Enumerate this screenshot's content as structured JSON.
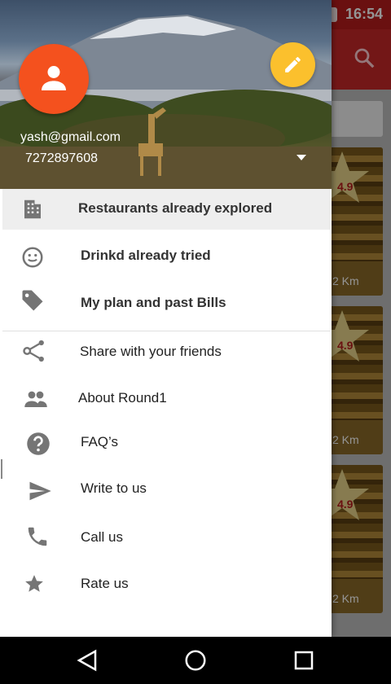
{
  "status_bar": {
    "time": "16:54"
  },
  "background": {
    "cards": [
      {
        "rating": "4.9",
        "distance": "2 Km"
      },
      {
        "rating": "4.9",
        "distance": "2 Km"
      },
      {
        "rating": "4.9",
        "distance": "2 Km"
      }
    ]
  },
  "drawer": {
    "account": {
      "email": "yash@gmail.com",
      "phone": "7272897608"
    },
    "menu": [
      {
        "label": "Restaurants already explored",
        "icon": "building-icon"
      },
      {
        "label": "Drinkd already tried",
        "icon": "smiley-icon"
      },
      {
        "label": "My plan and past Bills",
        "icon": "tag-icon"
      },
      {
        "label": "Share with your friends",
        "icon": "share-icon"
      },
      {
        "label": "About Round1",
        "icon": "people-icon"
      },
      {
        "label": "FAQ’s",
        "icon": "help-icon"
      },
      {
        "label": "Write to us",
        "icon": "send-icon"
      },
      {
        "label": "Call us",
        "icon": "phone-icon"
      },
      {
        "label": "Rate us",
        "icon": "star-icon"
      }
    ]
  },
  "colors": {
    "primary": "#c62828",
    "avatar": "#f4511e",
    "fab": "#fbc02d",
    "icon": "#757575"
  }
}
